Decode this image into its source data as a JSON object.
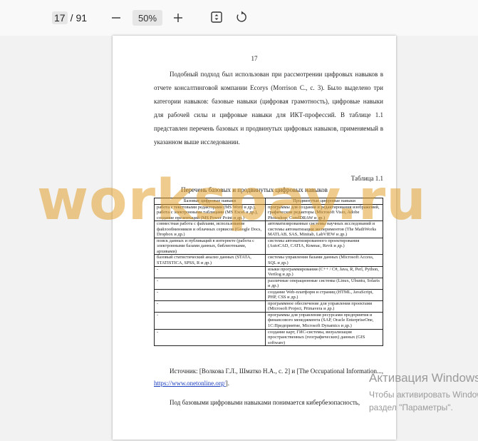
{
  "toolbar": {
    "current_page": "17",
    "separator": "/",
    "total_pages": "91",
    "zoom": "50%"
  },
  "page": {
    "number": "17",
    "para1": "Подобный подход был использован при рассмотрении цифровых навыков в отчете консалтинговой компании Ecorys (Morrison C., с. 3). Было выделено три категории навыков: базовые навыки (цифровая грамотность), цифровые навыки для рабочей силы и цифровые навыки для ИКТ-профессий. В таблице 1.1 представлен перечень базовых и продвинутых цифровых навыков, применяемый в указанном выше исследовании.",
    "table_caption": "Таблица 1.1",
    "table_title": "Перечень базовых и продвинутых цифровых навыков",
    "table": {
      "headers": [
        "Базовые цифровые навыки",
        "Продвинутые цифровые навыки"
      ],
      "rows": [
        [
          "работа с текстовыми редакторами (MS Word и др.), работа с электронными таблицами (MS Excel и др.), создание презентаций (MS Power Point и др.)",
          "программы для создания и редактирования изображений, графические редакторы (Microsoft Visio, Adobe Photoshop, CorelDRAW и др.)"
        ],
        [
          "совместная работа с файлами, использование файлообменников и облачных сервисов (Google Docs, Dropbox и др.)",
          "автоматизированные системы научных исследований и системы автоматизации экспериментов (The MathWorks MATLAB, SAS, Minitab, LabVIEW и др.)"
        ],
        [
          "поиск данных и публикаций в интернете (работа с электронными базами данных, библиотеками, архивами)",
          "системы автоматизированного проектирования (AutoCAD, CATIA, Компас, Revit и др.)"
        ],
        [
          "базовый статистический анализ данных (STATA, STATISTICA, SPSS, R и др.)",
          "системы управления базами данных (Microsoft Access, SQL и др.)"
        ],
        [
          "-",
          "языки программирования (C++ / C#, Java, R, Perl, Python, Verilog и др.)"
        ],
        [
          "-",
          "различные операционные системы (Linux, Ubuntu, Solaris и др.)"
        ],
        [
          "-",
          "создание Web-платформ и страниц (HTML, JavaScript, PHP, CSS и др.)"
        ],
        [
          "-",
          "программное обеспечение для управления проектами (Microsoft Project, Primavera и др.)"
        ],
        [
          "-",
          "программы для управления ресурсами предприятия и финансового менеджмента (SAP, Oracle EnterpriseOne, 1С:Предприятие, Microsoft Dynamics и др.)"
        ],
        [
          "-",
          "создание карт, ГИС-системы, визуализация пространственных (географических) данных (GIS software)"
        ]
      ]
    },
    "source_prefix": "Источник: [Волкова Г.Л., Шматко Н.А., с. 2] и [The Occupational Information..., ",
    "source_link": "https://www.onetonline.org/",
    "source_suffix": "].",
    "last_para": "Под базовыми цифровыми навыками понимается кибербезопасность,"
  },
  "watermark": "workspay.ru",
  "activation": {
    "title": "Активация Windows",
    "line1": "Чтобы активировать Windows, перейдите в",
    "line2": "раздел \"Параметры\"."
  }
}
